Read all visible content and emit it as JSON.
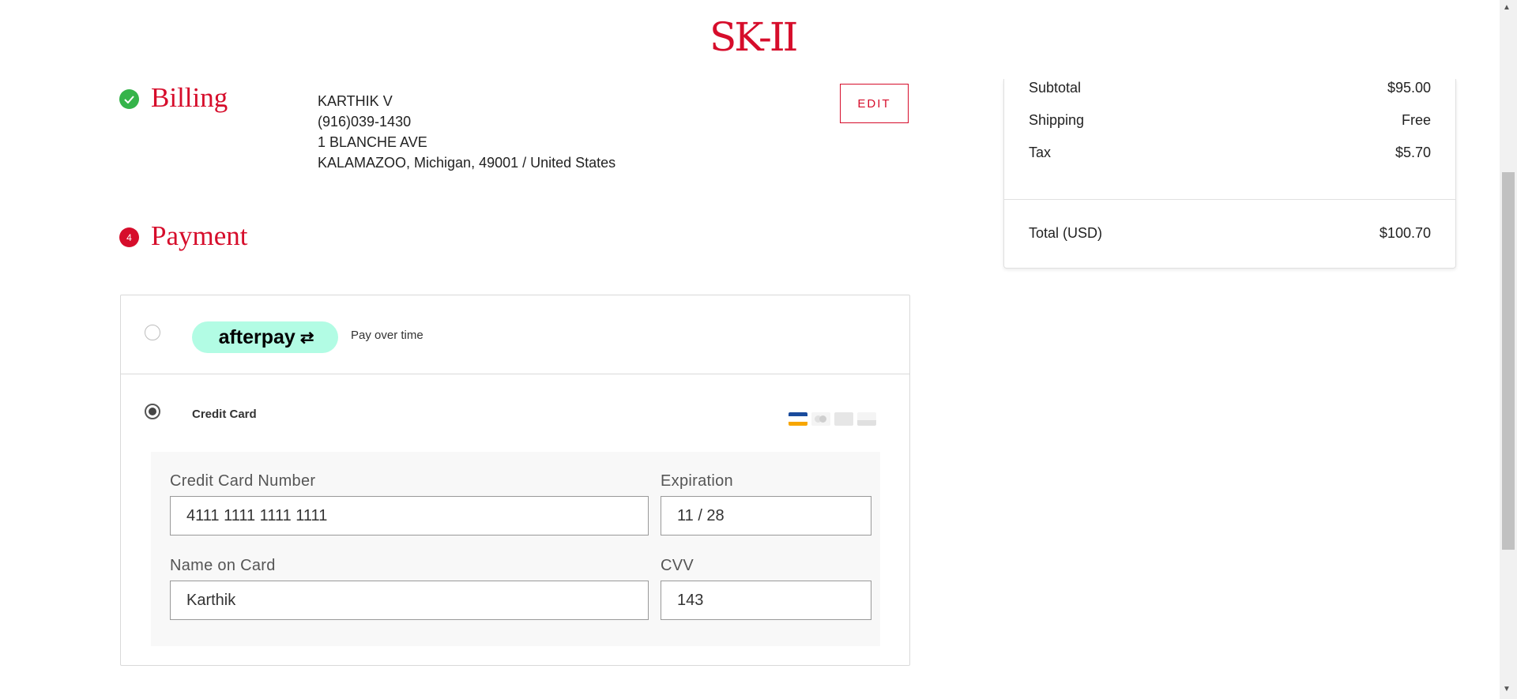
{
  "brand": {
    "logo_text": "SK-II",
    "accent_color": "#d60d2b"
  },
  "billing": {
    "title": "Billing",
    "status_icon": "checkmark-icon",
    "address_lines": [
      "KARTHIK V",
      "(916)039-1430",
      "1 BLANCHE AVE",
      "KALAMAZOO, Michigan, 49001 / United States"
    ],
    "edit_label": "EDIT"
  },
  "payment": {
    "step_number": "4",
    "title": "Payment",
    "afterpay": {
      "badge_text": "afterpay",
      "badge_mark": "⇄",
      "description": "Pay over time",
      "selected": false
    },
    "credit_card": {
      "label": "Credit Card",
      "selected": true,
      "card_icons": [
        "visa-icon",
        "mastercard-icon",
        "amex-icon",
        "discover-icon"
      ],
      "number_label": "Credit Card Number",
      "number_value": "4111 1111 1111 1111",
      "expiration_label": "Expiration",
      "expiration_value": "11 / 28",
      "name_label": "Name on Card",
      "name_value": "Karthik",
      "cvv_label": "CVV",
      "cvv_value": "143"
    }
  },
  "summary": {
    "subtotal_label": "Subtotal",
    "subtotal_value": "$95.00",
    "shipping_label": "Shipping",
    "shipping_value": "Free",
    "tax_label": "Tax",
    "tax_value": "$5.70",
    "total_label": "Total (USD)",
    "total_value": "$100.70"
  }
}
